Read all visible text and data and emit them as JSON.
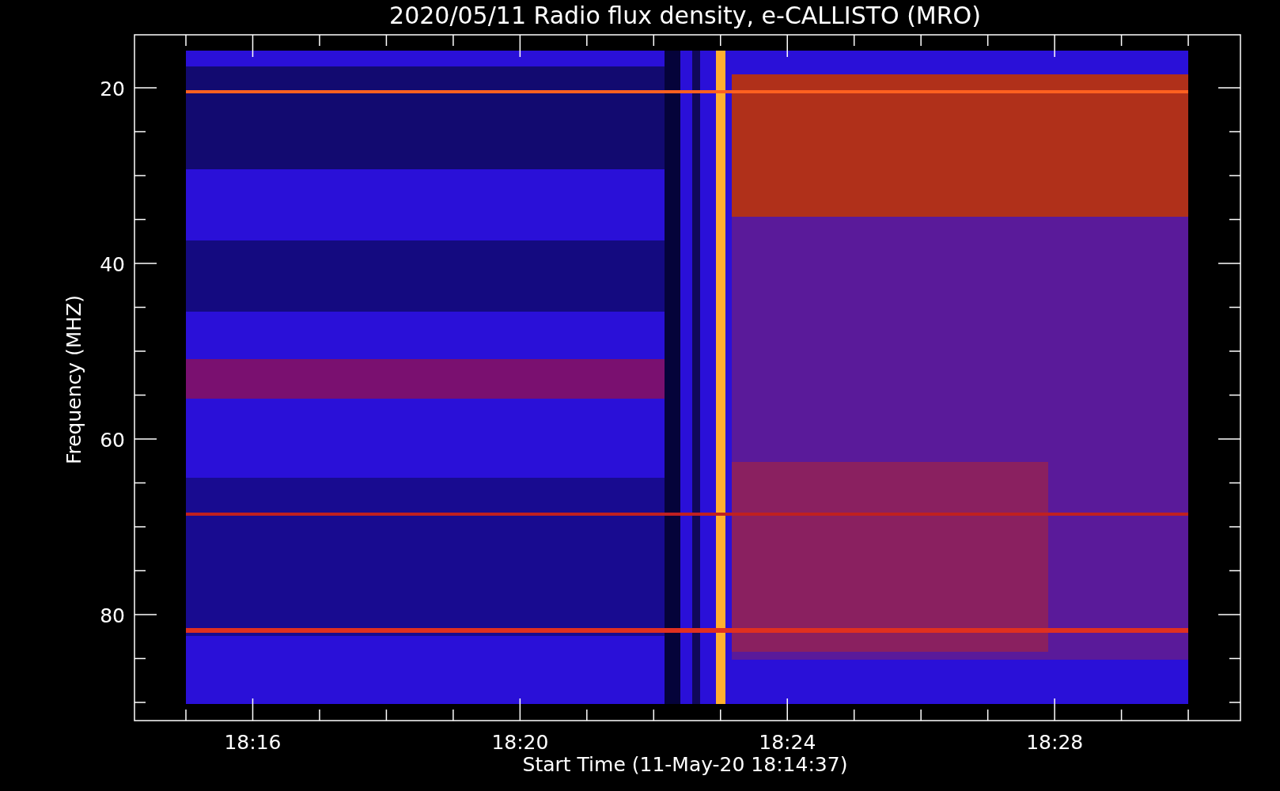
{
  "title": "2020/05/11  Radio flux density, e-CALLISTO (MRO)",
  "plot": {
    "ylabel": "Frequency (MHZ)",
    "xlabel": "Start Time (11-May-20 18:14:37)",
    "yticks": [
      {
        "label": "20"
      },
      {
        "label": "40"
      },
      {
        "label": "60"
      },
      {
        "label": "80"
      }
    ],
    "xticks": [
      {
        "label": "18:16"
      },
      {
        "label": "18:20"
      },
      {
        "label": "18:24"
      },
      {
        "label": "18:28"
      }
    ]
  }
}
